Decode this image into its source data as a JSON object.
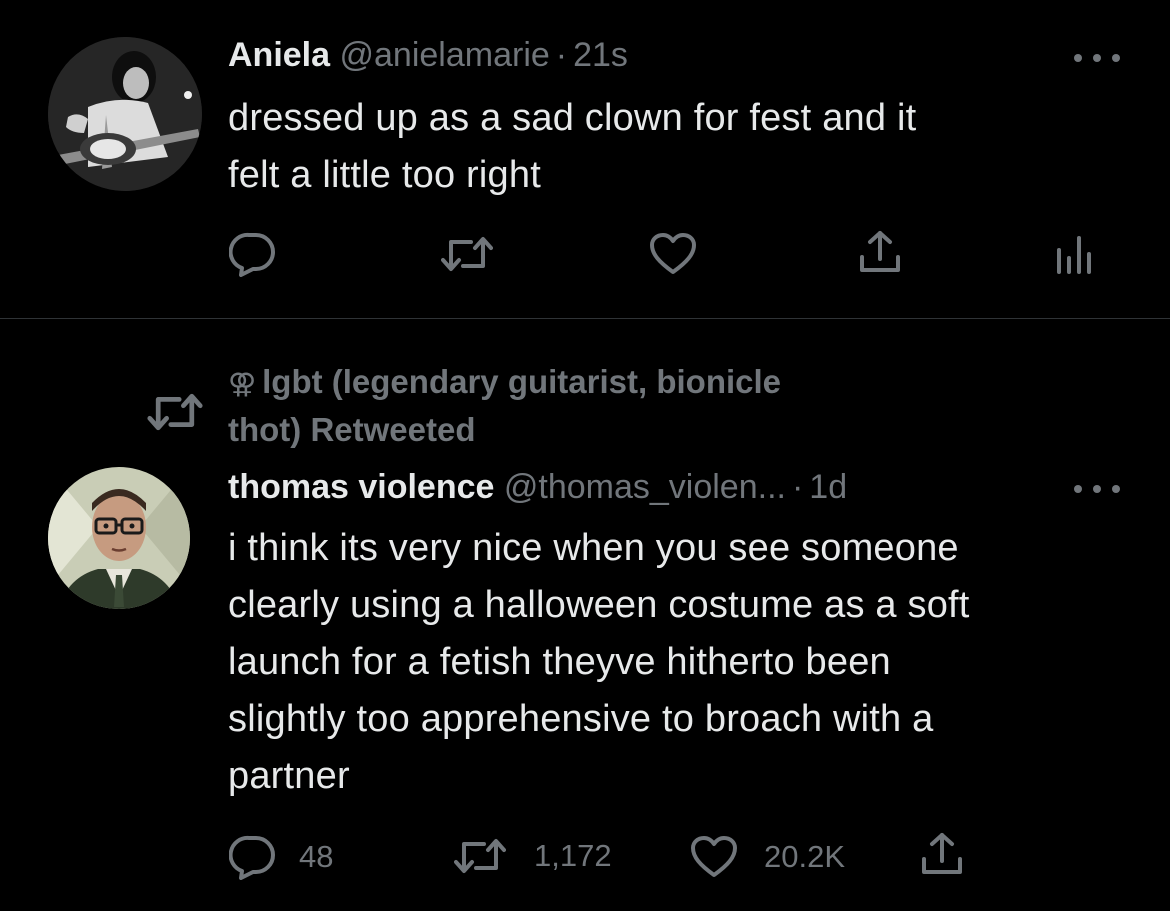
{
  "tweet1": {
    "display_name": "Aniela",
    "handle": "@anielamarie",
    "separator": "·",
    "time": "21s",
    "text": "dressed up as a sad clown for fest and it\nfelt a little too right",
    "actions": {
      "reply_icon": "reply-icon",
      "retweet_icon": "retweet-icon",
      "like_icon": "heart-icon",
      "share_icon": "share-icon",
      "analytics_icon": "analytics-icon"
    }
  },
  "tweet2": {
    "retweet_context": {
      "emoji": "⚢",
      "text": "lgbt (legendary guitarist, bionicle\nthot) Retweeted"
    },
    "display_name": "thomas violence",
    "handle": "@thomas_violen...",
    "separator": "·",
    "time": "1d",
    "text": "i think its very nice when you see someone\nclearly using a halloween costume as a soft\nlaunch for a fetish theyve hitherto been\nslightly too apprehensive to broach with a\npartner",
    "actions": {
      "reply_count": "48",
      "retweet_count": "1,172",
      "like_count": "20.2K"
    }
  },
  "colors": {
    "background": "#000000",
    "text_primary": "#e7e9ea",
    "text_secondary": "#71767b",
    "divider": "#2f3336"
  }
}
